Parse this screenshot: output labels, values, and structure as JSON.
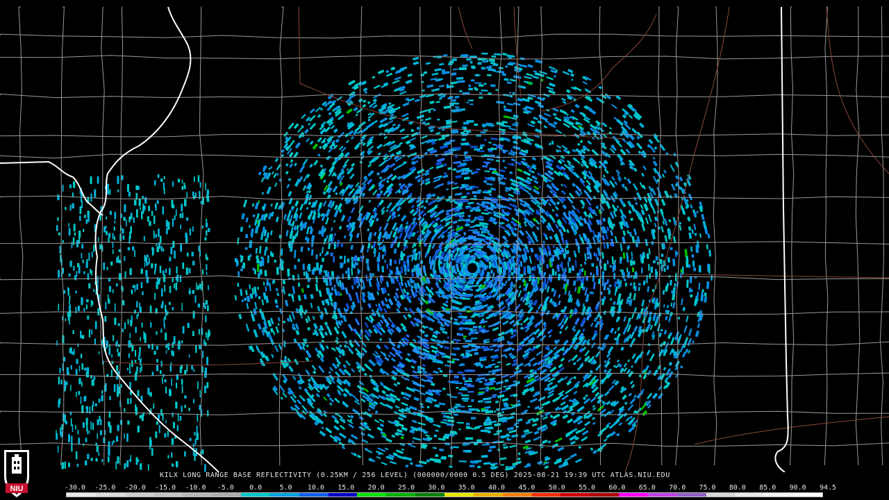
{
  "caption": "KILX LONG RANGE BASE REFLECTIVITY (0.25KM / 256 LEVEL) (000000/0000 0.5 DEG) 2025-08-21 19:39 UTC  ATLAS.NIU.EDU",
  "logo": {
    "text": "NIU",
    "icon": "niu-logo-icon",
    "color": "#c8102e"
  },
  "colorbar": {
    "labels": [
      "-30.0",
      "-25.0",
      "-20.0",
      "-15.0",
      "-10.0",
      "-5.0",
      "0.0",
      "5.0",
      "10.0",
      "15.0",
      "20.0",
      "25.0",
      "30.0",
      "35.0",
      "40.0",
      "45.0",
      "50.0",
      "55.0",
      "60.0",
      "65.0",
      "70.0",
      "75.0",
      "80.0",
      "85.0",
      "90.0",
      "94.5"
    ],
    "colors": [
      "#e8e8e8",
      "#dcdcdc",
      "#cfcfcf",
      "#c4c4c4",
      "#b8b8b8",
      "#adadad",
      "#00c8c8",
      "#00a0e0",
      "#1060f0",
      "#0000c8",
      "#00e000",
      "#00b000",
      "#008000",
      "#e8e800",
      "#e8b000",
      "#f08000",
      "#f03000",
      "#d00000",
      "#b00000",
      "#ff00ff",
      "#c040e8",
      "#9060c8",
      "#d8d8d8",
      "#e8e8e8",
      "#f4f4f4",
      "#ffffff"
    ]
  },
  "radar": {
    "site": "KILX",
    "center_icon": "radar-site-icon"
  }
}
